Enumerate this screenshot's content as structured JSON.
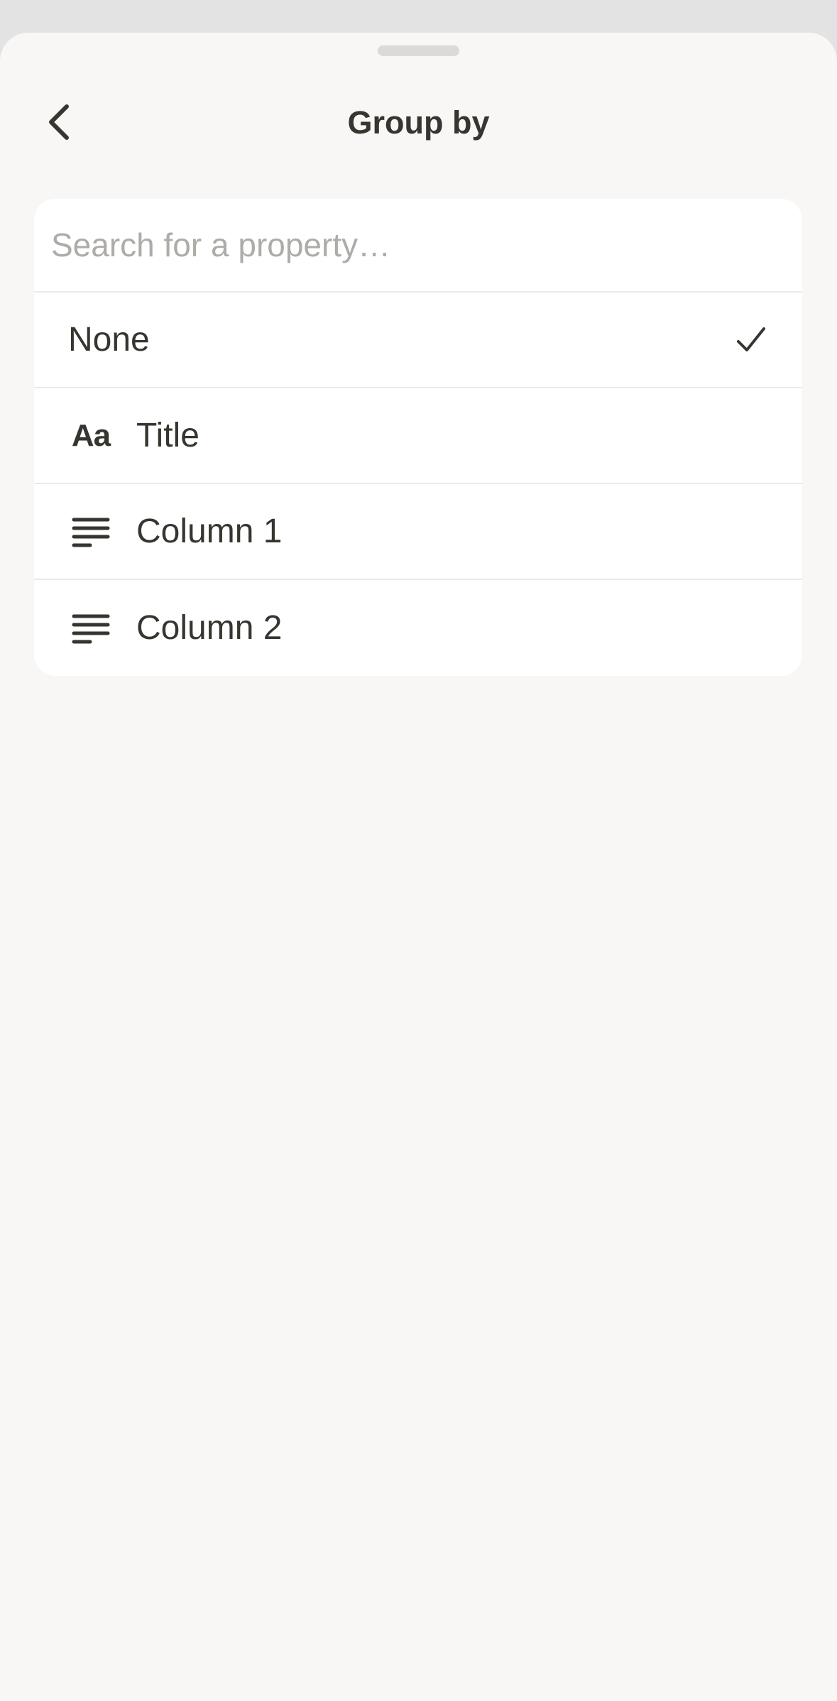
{
  "header": {
    "title": "Group by"
  },
  "search": {
    "placeholder": "Search for a property…",
    "value": ""
  },
  "options": [
    {
      "label": "None",
      "icon": "none",
      "selected": true
    },
    {
      "label": "Title",
      "icon": "title-aa-icon",
      "selected": false,
      "glyph": "Aa"
    },
    {
      "label": "Column 1",
      "icon": "text-lines-icon",
      "selected": false
    },
    {
      "label": "Column 2",
      "icon": "text-lines-icon",
      "selected": false
    }
  ],
  "colors": {
    "text": "#37352f",
    "placeholder": "#aeaca8",
    "sheet_background": "#f8f7f5",
    "panel_background": "#ffffff",
    "divider": "#ebeae8"
  }
}
